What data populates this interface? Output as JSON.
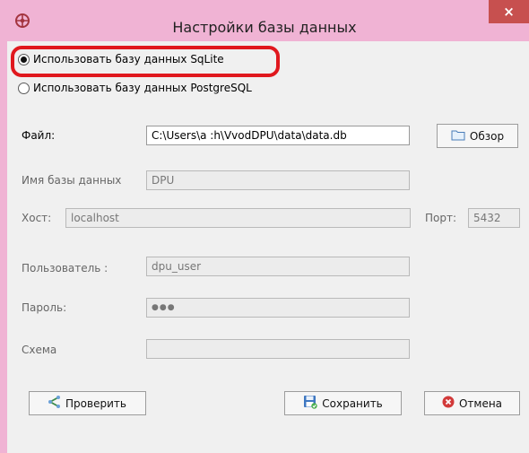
{
  "window": {
    "title": "Настройки базы данных",
    "close_glyph": "×"
  },
  "db_choice": {
    "sqlite_label": "Использовать базу данных SqLite",
    "postgres_label": "Использовать базу данных PostgreSQL",
    "selected": "sqlite"
  },
  "form": {
    "file_label": "Файл:",
    "file_value": "C:\\Users\\a            :h\\VvodDPU\\data\\data.db",
    "browse_label": "Обзор",
    "dbname_label": "Имя базы данных",
    "dbname_value": "DPU",
    "host_label": "Хост:",
    "host_value": "localhost",
    "port_label": "Порт:",
    "port_value": "5432",
    "user_label": "Пользователь :",
    "user_value": "dpu_user",
    "password_label": "Пароль:",
    "password_value": "●●●",
    "schema_label": "Схема",
    "schema_value": ""
  },
  "buttons": {
    "check_label": "Проверить",
    "save_label": "Сохранить",
    "cancel_label": "Отмена"
  },
  "icons": {
    "app": "app-logo-icon",
    "folder": "folder-icon",
    "check": "network-connect-icon",
    "save": "floppy-save-icon",
    "cancel": "cancel-icon"
  },
  "colors": {
    "title_bar": "#f0b3d4",
    "close_button": "#c7504f",
    "highlight": "#e0181e"
  }
}
